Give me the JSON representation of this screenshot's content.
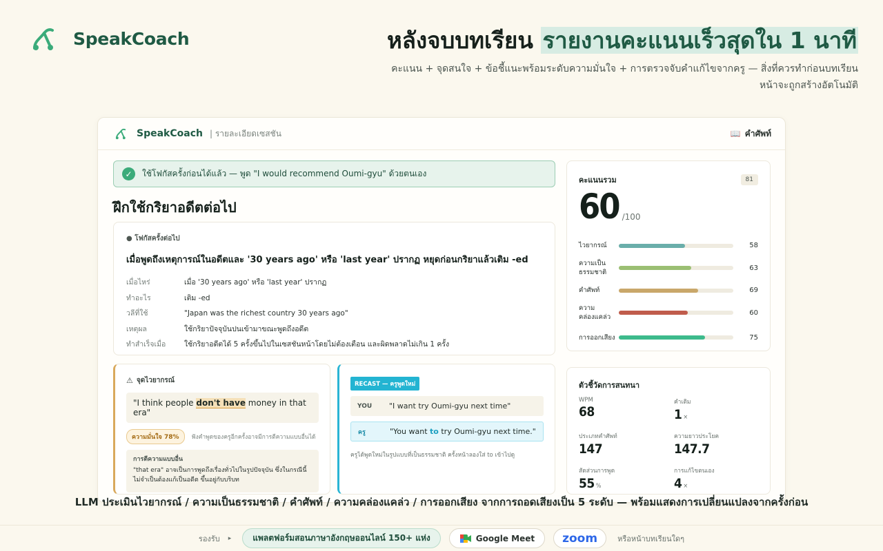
{
  "brand": {
    "name": "SpeakCoach"
  },
  "hero": {
    "title_plain": "หลังจบบทเรียน ",
    "title_highlight": "รายงานคะแนนเร็วสุดใน 1 นาที",
    "subtitle_line1": "คะแนน + จุดสนใจ + ข้อชี้แนะพร้อมระดับความมั่นใจ + การตรวจจับคำแก้ไขจากครู — สิ่งที่ควรทำก่อนบทเรียน",
    "subtitle_line2": "หน้าจะถูกสร้างอัตโนมัติ"
  },
  "app": {
    "brand": "SpeakCoach",
    "section": "| รายละเอียดเซสชัน",
    "dict_label": "คำศัพท์",
    "banner": "ใช้โฟกัสครั้งก่อนได้แล้ว — พูด \"I would recommend Oumi-gyu\" ด้วยตนเอง",
    "section_title": "ฝึกใช้กริยาอดีตต่อไป",
    "focus": {
      "kicker": "● โฟกัสครั้งต่อไป",
      "headline": "เมื่อพูดถึงเหตุการณ์ในอดีตและ '30 years ago' หรือ 'last year' ปรากฏ หยุดก่อนกริยาแล้วเติม -ed",
      "rows": [
        {
          "k": "เมื่อไหร่",
          "v": "เมื่อ '30 years ago' หรือ 'last year' ปรากฏ"
        },
        {
          "k": "ทำอะไร",
          "v": "เติม -ed"
        },
        {
          "k": "วลีที่ใช้",
          "v": "\"Japan was the richest country 30 years ago\""
        },
        {
          "k": "เหตุผล",
          "v": "ใช้กริยาปัจจุบันปนเข้ามาขณะพูดถึงอดีต"
        },
        {
          "k": "ทำสำเร็จเมื่อ",
          "v": "ใช้กริยาอดีตได้ 5 ครั้งขึ้นไปในเซสชันหน้าโดยไม่ต้องเตือน และผิดพลาดไม่เกิน 1 ครั้ง"
        }
      ]
    },
    "grammar": {
      "kicker": "จุดไวยากรณ์",
      "quote_pre": "\"I think people ",
      "quote_err": "don't have",
      "quote_post": " money in that era\"",
      "confidence": "ความมั่นใจ 78%",
      "confidence_note": "ฟังคำพูดของครูอีกครั้งอาจมีการตีความแบบอื่นได้",
      "alt_title": "การตีความแบบอื่น",
      "alt_body": "\"that era\" อาจเป็นการพูดถึงเรื่องทั่วไปในรูปปัจจุบัน ซึ่งในกรณีนี้ไม่จำเป็นต้องแก้เป็นอดีต ขึ้นอยู่กับบริบท"
    },
    "recast": {
      "tag": "RECAST — ครูพูดใหม่",
      "you_label": "YOU",
      "you_text": "\"I want try Oumi-gyu next time\"",
      "teacher_label": "ครู",
      "teacher_pre": "\"You want ",
      "teacher_add": "to",
      "teacher_post": " try Oumi-gyu next time.\"",
      "note": "ครูได้พูดใหม่ในรูปแบบที่เป็นธรรมชาติ ครั้งหน้าลองใส่ to เข้าไปดู"
    },
    "score": {
      "label": "คะแนนรวม",
      "badge": "81",
      "value": "60",
      "max": "/100",
      "items": [
        {
          "label": "ไวยากรณ์",
          "value": 58,
          "display": "58",
          "color": "#6aaeaa"
        },
        {
          "label": "ความเป็นธรรมชาติ",
          "value": 63,
          "display": "63",
          "color": "#9bbf73"
        },
        {
          "label": "คำศัพท์",
          "value": 69,
          "display": "69",
          "color": "#c9a76a"
        },
        {
          "label": "ความคล่องแคล่ว",
          "value": 60,
          "display": "60",
          "color": "#c05c4c"
        },
        {
          "label": "การออกเสียง",
          "value": 75,
          "display": "75",
          "color": "#3dba8c"
        }
      ]
    },
    "metrics": {
      "title": "ตัวชี้วัดการสนทนา",
      "items": [
        {
          "label": "WPM",
          "value": "68",
          "unit": ""
        },
        {
          "label": "คำเติม",
          "value": "1",
          "unit": "×"
        },
        {
          "label": "ประเภทคำศัพท์",
          "value": "147",
          "unit": ""
        },
        {
          "label": "ความยาวประโยค",
          "value": "147.7",
          "unit": ""
        },
        {
          "label": "สัดส่วนการพูด",
          "value": "55",
          "unit": "%"
        },
        {
          "label": "การแก้ไขตนเอง",
          "value": "4",
          "unit": "×"
        }
      ]
    }
  },
  "caption": "LLM ประเมินไวยากรณ์ / ความเป็นธรรมชาติ / คำศัพท์ / ความคล่องแคล่ว / การออกเสียง จากการถอดเสียงเป็น 5 ระดับ — พร้อมแสดงการเปลี่ยนแปลงจากครั้งก่อน",
  "footer": {
    "support": "รองรับ",
    "platform": "แพลตฟอร์มสอนภาษาอังกฤษออนไลน์ 150+ แห่ง",
    "meet": "Google Meet",
    "zoom": "zoom",
    "other": "หรือหน้าบทเรียนใดๆ"
  }
}
